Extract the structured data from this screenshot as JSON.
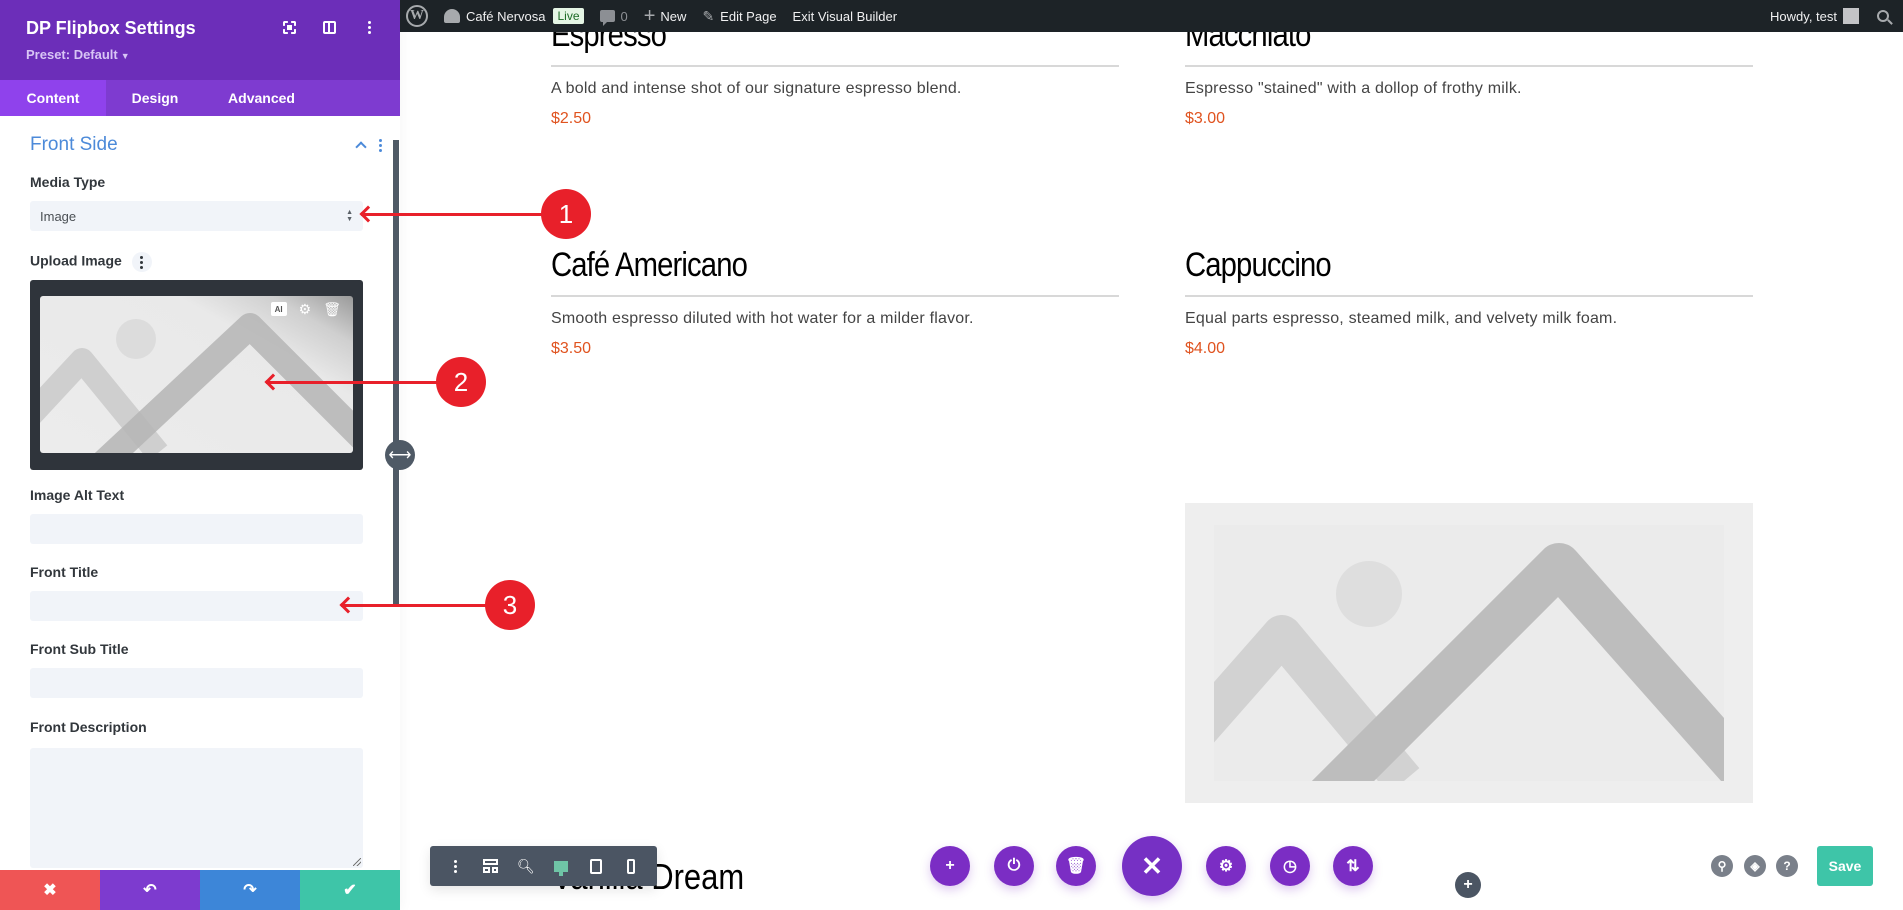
{
  "adminbar": {
    "site_name": "Café Nervosa",
    "live_badge": "Live",
    "comments_count": "0",
    "new_label": "New",
    "edit_page_label": "Edit Page",
    "exit_builder_label": "Exit Visual Builder",
    "howdy_label": "Howdy, test"
  },
  "panel": {
    "title": "DP Flipbox Settings",
    "preset": "Preset: Default",
    "tabs": [
      {
        "label": "Content",
        "active": true
      },
      {
        "label": "Design",
        "active": false
      },
      {
        "label": "Advanced",
        "active": false
      }
    ],
    "section_title": "Front Side",
    "fields": {
      "media_type_label": "Media Type",
      "media_type_value": "Image",
      "upload_image_label": "Upload Image",
      "ai_badge": "AI",
      "image_alt_label": "Image Alt Text",
      "image_alt_value": "",
      "front_title_label": "Front Title",
      "front_title_value": "",
      "front_subtitle_label": "Front Sub Title",
      "front_subtitle_value": "",
      "front_description_label": "Front Description",
      "front_description_value": ""
    },
    "footer": {
      "discard_icon": "✖",
      "undo_icon": "↶",
      "redo_icon": "↷",
      "apply_icon": "✔"
    }
  },
  "page": {
    "menu_items": [
      {
        "title": "Espresso",
        "description": "A bold and intense shot of our signature espresso blend.",
        "price": "$2.50"
      },
      {
        "title": "Macchiato",
        "description": "Espresso \"stained\" with a dollop of frothy milk.",
        "price": "$3.00"
      },
      {
        "title": "Café Americano",
        "description": "Smooth espresso diluted with hot water for a milder flavor.",
        "price": "$3.50"
      },
      {
        "title": "Cappuccino",
        "description": "Equal parts espresso, steamed milk, and velvety milk foam.",
        "price": "$4.00"
      }
    ],
    "partial_title": "Vanilla Dream"
  },
  "builder": {
    "save_label": "Save",
    "active_view": "desktop"
  },
  "annotations": [
    {
      "number": "1",
      "target": "media-type-select"
    },
    {
      "number": "2",
      "target": "upload-image-preview"
    },
    {
      "number": "3",
      "target": "front-title-input"
    }
  ],
  "colors": {
    "panel_header": "#6c2eb9",
    "tab_active": "#8f42ec",
    "section_title": "#4c8ad9",
    "price": "#e0531f",
    "save": "#3ec5a8",
    "annotation": "#e8202a"
  }
}
